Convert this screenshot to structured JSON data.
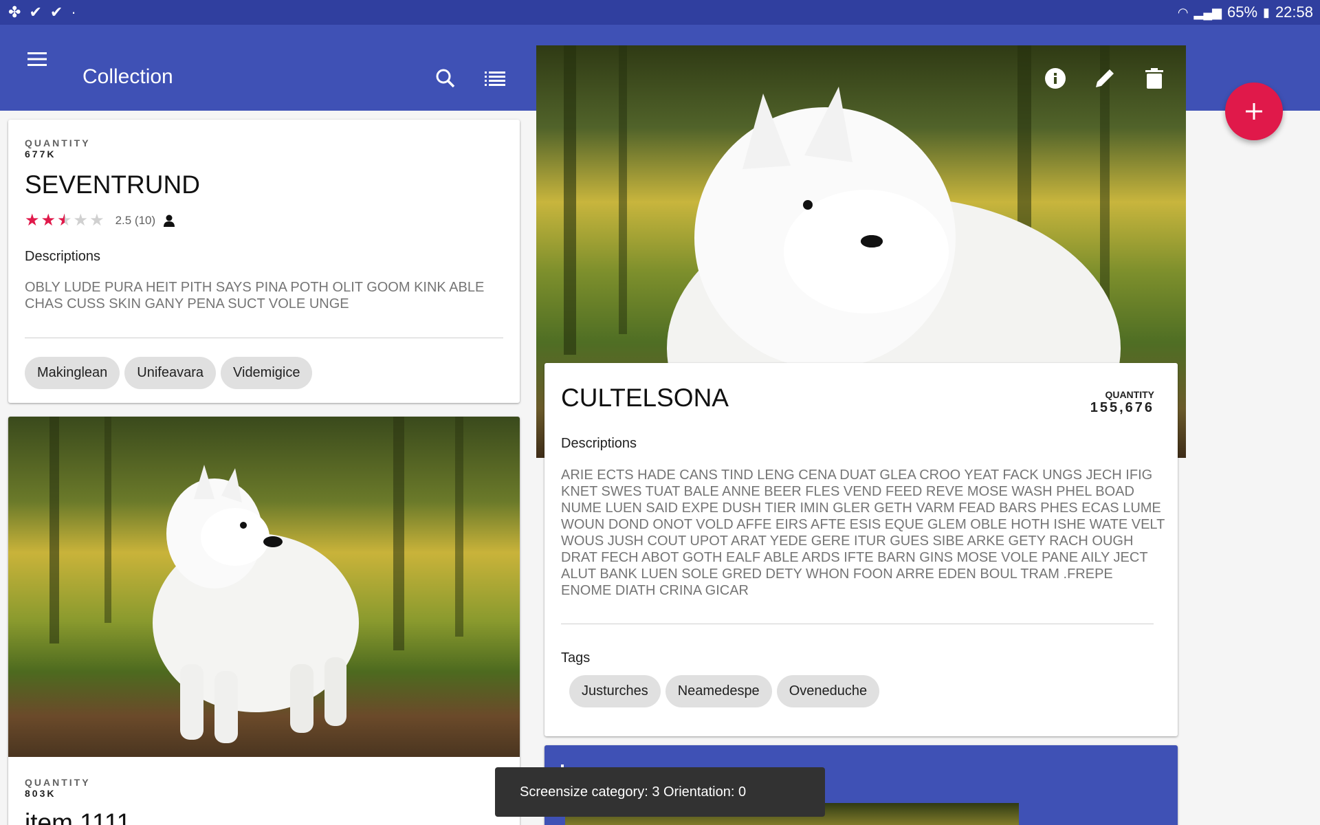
{
  "status_bar": {
    "battery": "65%",
    "time": "22:58"
  },
  "app_bar": {
    "title": "Collection"
  },
  "list": {
    "items": [
      {
        "quantity_label": "QUANTITY",
        "quantity": "677K",
        "title": "SEVENTRUND",
        "rating": 2.5,
        "rating_text": "2.5 (10)",
        "descriptions_heading": "Descriptions",
        "description": "OBLY LUDE PURA HEIT PITH SAYS PINA POTH OLIT GOOM KINK ABLE CHAS CUSS SKIN GANY PENA SUCT VOLE UNGE",
        "tags": [
          "Makinglean",
          "Unifeavara",
          "Videmigice"
        ]
      },
      {
        "quantity_label": "QUANTITY",
        "quantity": "803K",
        "title": "item 1111"
      }
    ]
  },
  "detail": {
    "title": "CULTELSONA",
    "quantity_label": "QUANTITY",
    "quantity": "155,676",
    "descriptions_heading": "Descriptions",
    "description": "ARIE ECTS HADE CANS TIND LENG CENA DUAT GLEA CROO YEAT FACK UNGS JECH IFIG KNET SWES TUAT BALE ANNE BEER FLES VEND FEED REVE MOSE WASH PHEL BOAD NUME LUEN SAID EXPE DUSH TIER IMIN GLER GETH VARM FEAD BARS PHES ECAS LUME WOUN DOND ONOT VOLD AFFE EIRS AFTE ESIS EQUE GLEM OBLE HOTH ISHE WATE VELT WOUS JUSH COUT UPOT ARAT YEDE GERE ITUR GUES SIBE ARKE GETY RACH OUGH DRAT FECH ABOT GOTH EALF ABLE ARDS IFTE BARN GINS MOSE VOLE PANE AILY JECT ALUT BANK LUEN SOLE GRED DETY WHON FOON ARRE EDEN BOUL TRAM .FREPE ENOME DIATH CRINA GICAR",
    "tags_heading": "Tags",
    "tags": [
      "Justurches",
      "Neamedespe",
      "Oveneduche"
    ]
  },
  "snackbar": {
    "text": "Screensize category: 3 Orientation: 0"
  },
  "colors": {
    "primary": "#3f51b5",
    "primary_dark": "#303f9f",
    "accent": "#e0194a"
  }
}
